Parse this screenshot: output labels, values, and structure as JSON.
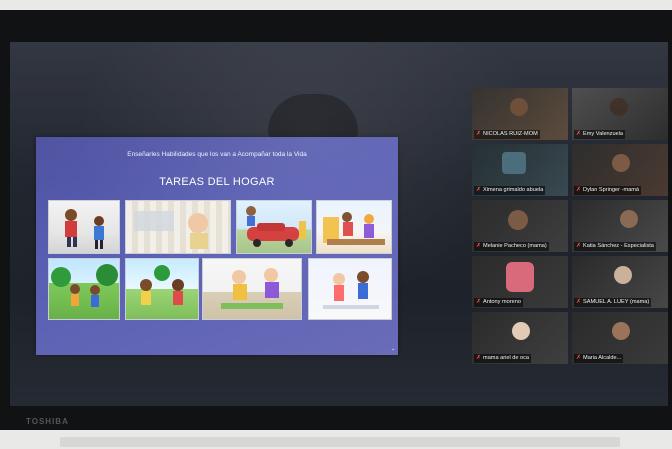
{
  "device": {
    "brand": "TOSHIBA"
  },
  "slide": {
    "subtitle": "Enseñarles Habilidades que los van a Acompañar toda la Vida",
    "title": "TAREAS DEL HOGAR"
  },
  "participants": [
    {
      "name": "NICOLAS RUIZ-MOM"
    },
    {
      "name": "Emy Valenzuela"
    },
    {
      "name": "Ximena grimaldo abuela"
    },
    {
      "name": "Dylan Springer -mamá"
    },
    {
      "name": "Melanie Pacheco (mama)"
    },
    {
      "name": "Katia Sánchez - Especialista"
    },
    {
      "name": "Antony moreno"
    },
    {
      "name": "SAMUEL A. LUEY (mama)"
    },
    {
      "name": "mama ariel de oca"
    },
    {
      "name": "Maria Alcalde..."
    }
  ],
  "colors": {
    "slide_bg": "#5a5fb3",
    "active_speaker_border": "#c9d44a",
    "mic_muted": "#ff4d4d"
  }
}
